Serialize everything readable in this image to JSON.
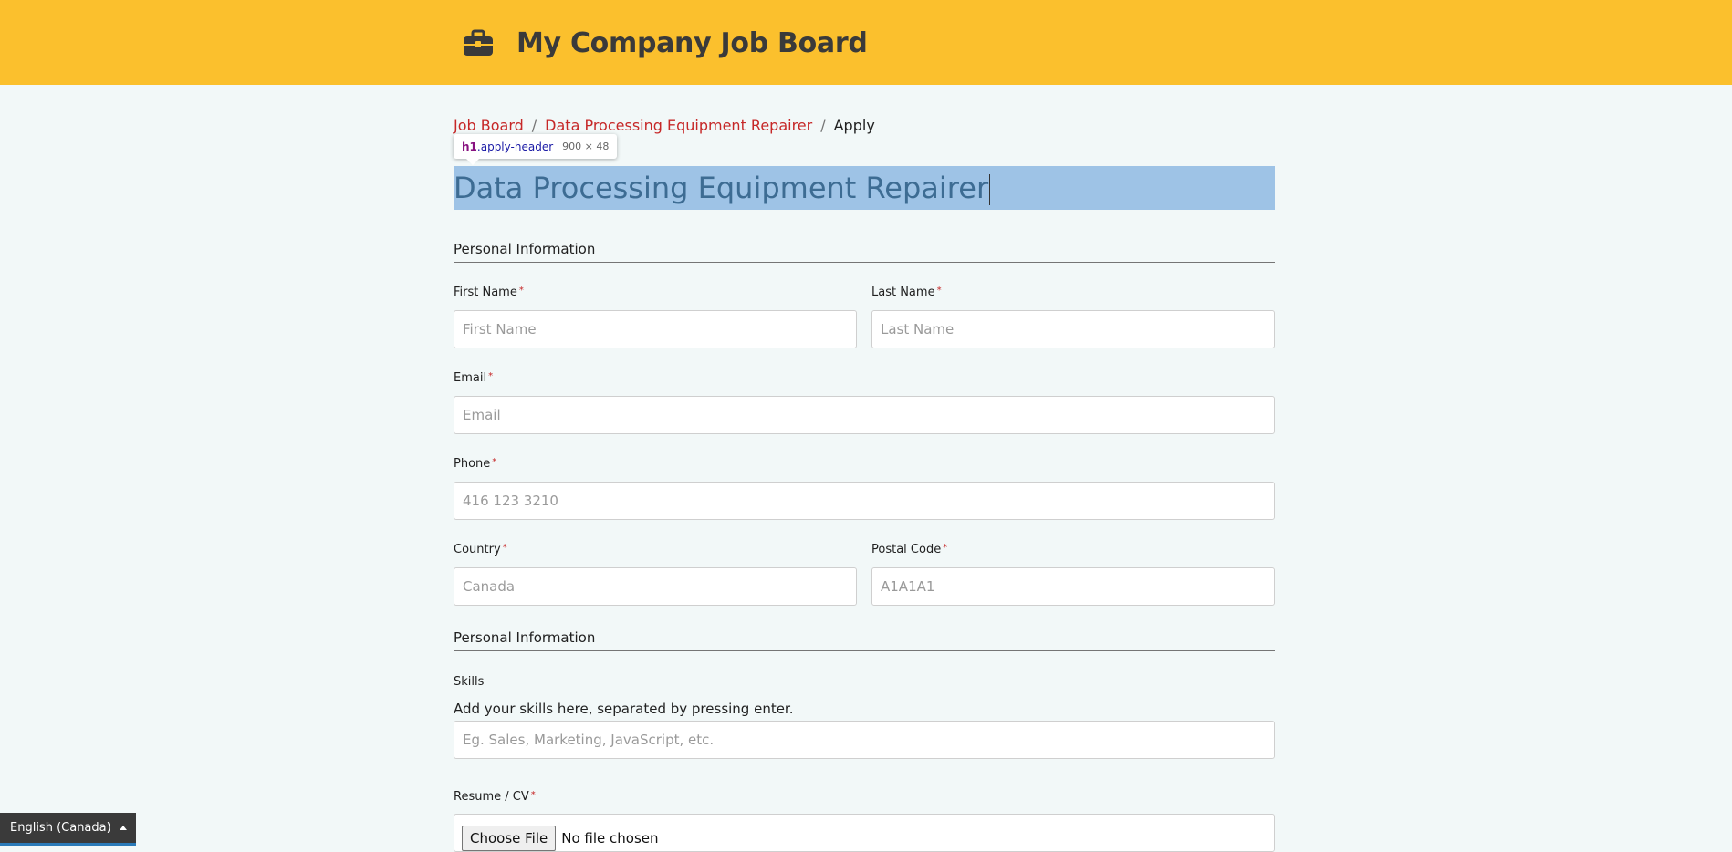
{
  "header": {
    "brand_icon": "briefcase-icon",
    "title": "My Company Job Board",
    "background_color": "#fbc02d"
  },
  "breadcrumb": {
    "items": [
      "Job Board",
      "Data Processing Equipment Repairer"
    ],
    "separator": "/",
    "current": "Apply"
  },
  "devtools_tooltip": {
    "tag": "h1",
    "class": ".apply-header",
    "size": "900 × 48"
  },
  "page_title": "Data Processing Equipment Repairer",
  "sections": {
    "personal": "Personal Information",
    "additional": "Personal Information"
  },
  "form": {
    "required_marker": "*",
    "first_name": {
      "label": "First Name",
      "placeholder": "First Name"
    },
    "last_name": {
      "label": "Last Name",
      "placeholder": "Last Name"
    },
    "email": {
      "label": "Email",
      "placeholder": "Email"
    },
    "phone": {
      "label": "Phone",
      "placeholder": "416 123 3210"
    },
    "country": {
      "label": "Country",
      "placeholder": "Canada"
    },
    "postal_code": {
      "label": "Postal Code",
      "placeholder": "A1A1A1"
    },
    "skills": {
      "label": "Skills",
      "hint": "Add your skills here, separated by pressing enter.",
      "placeholder": "Eg. Sales, Marketing, JavaScript, etc."
    },
    "resume": {
      "label": "Resume / CV",
      "button": "Choose File",
      "status": "No file chosen"
    }
  },
  "language_switcher": {
    "label": "English (Canada)"
  }
}
